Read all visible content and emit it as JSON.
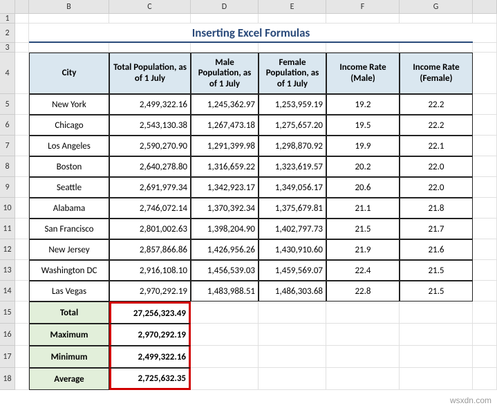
{
  "columns": [
    "",
    "B",
    "C",
    "D",
    "E",
    "F",
    "G"
  ],
  "title": "Inserting Excel Formulas",
  "headers": {
    "city": "City",
    "total": "Total Population, as of 1 July",
    "male": "Male Population, as of 1 July",
    "female": "Female Population, as of 1 July",
    "income_m": "Income Rate (Male)",
    "income_f": "Income Rate (Female)"
  },
  "rows": [
    {
      "city": "New York",
      "total": "2,499,322.16",
      "male": "1,245,362.97",
      "female": "1,253,959.19",
      "im": "19.2",
      "if": "22.2"
    },
    {
      "city": "Chicago",
      "total": "2,543,130.38",
      "male": "1,267,473.18",
      "female": "1,275,657.20",
      "im": "19.5",
      "if": "22.2"
    },
    {
      "city": "Los Angeles",
      "total": "2,590,270.90",
      "male": "1,291,399.98",
      "female": "1,298,870.92",
      "im": "19.9",
      "if": "22.1"
    },
    {
      "city": "Boston",
      "total": "2,640,278.80",
      "male": "1,316,659.22",
      "female": "1,323,619.57",
      "im": "20.2",
      "if": "22.0"
    },
    {
      "city": "Seattle",
      "total": "2,691,979.34",
      "male": "1,342,923.17",
      "female": "1,349,056.17",
      "im": "20.6",
      "if": "22.0"
    },
    {
      "city": "Alabama",
      "total": "2,746,072.14",
      "male": "1,370,392.34",
      "female": "1,375,679.81",
      "im": "21.1",
      "if": "21.8"
    },
    {
      "city": "San Francisco",
      "total": "2,801,002.63",
      "male": "1,398,204.90",
      "female": "1,402,797.73",
      "im": "21.5",
      "if": "21.7"
    },
    {
      "city": "New Jersey",
      "total": "2,857,866.86",
      "male": "1,426,956.26",
      "female": "1,430,910.60",
      "im": "21.9",
      "if": "21.6"
    },
    {
      "city": "Washington DC",
      "total": "2,916,108.10",
      "male": "1,456,539.03",
      "female": "1,459,569.07",
      "im": "22.4",
      "if": "21.5"
    },
    {
      "city": "Las Vegas",
      "total": "2,970,292.19",
      "male": "1,483,988.51",
      "female": "1,486,303.68",
      "im": "22.8",
      "if": "21.5"
    }
  ],
  "summary": [
    {
      "label": "Total",
      "value": "27,256,323.49"
    },
    {
      "label": "Maximum",
      "value": "2,970,292.19"
    },
    {
      "label": "Minimum",
      "value": "2,499,322.16"
    },
    {
      "label": "Average",
      "value": "2,725,632.35"
    }
  ],
  "watermark": "wsxdn.com",
  "chart_data": {
    "type": "table",
    "title": "Inserting Excel Formulas",
    "columns": [
      "City",
      "Total Population, as of 1 July",
      "Male Population, as of 1 July",
      "Female Population, as of 1 July",
      "Income Rate (Male)",
      "Income Rate (Female)"
    ],
    "data": [
      [
        "New York",
        2499322.16,
        1245362.97,
        1253959.19,
        19.2,
        22.2
      ],
      [
        "Chicago",
        2543130.38,
        1267473.18,
        1275657.2,
        19.5,
        22.2
      ],
      [
        "Los Angeles",
        2590270.9,
        1291399.98,
        1298870.92,
        19.9,
        22.1
      ],
      [
        "Boston",
        2640278.8,
        1316659.22,
        1323619.57,
        20.2,
        22.0
      ],
      [
        "Seattle",
        2691979.34,
        1342923.17,
        1349056.17,
        20.6,
        22.0
      ],
      [
        "Alabama",
        2746072.14,
        1370392.34,
        1375679.81,
        21.1,
        21.8
      ],
      [
        "San Francisco",
        2801002.63,
        1398204.9,
        1402797.73,
        21.5,
        21.7
      ],
      [
        "New Jersey",
        2857866.86,
        1426956.26,
        1430910.6,
        21.9,
        21.6
      ],
      [
        "Washington DC",
        2916108.1,
        1456539.03,
        1459569.07,
        22.4,
        21.5
      ],
      [
        "Las Vegas",
        2970292.19,
        1483988.51,
        1486303.68,
        22.8,
        21.5
      ]
    ],
    "summary": {
      "Total": 27256323.49,
      "Maximum": 2970292.19,
      "Minimum": 2499322.16,
      "Average": 2725632.35
    }
  }
}
